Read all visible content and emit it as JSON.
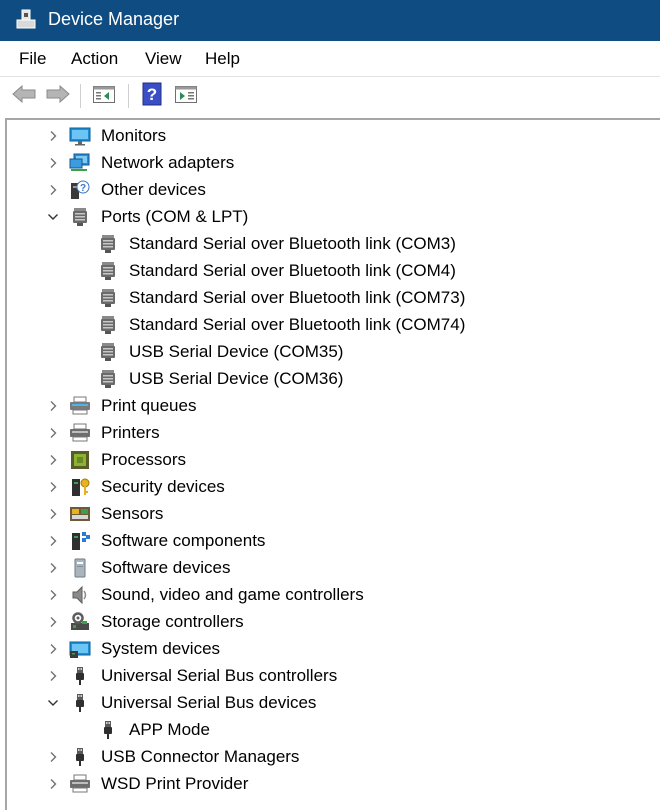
{
  "window": {
    "title": "Device Manager"
  },
  "menu": [
    "File",
    "Action",
    "View",
    "Help"
  ],
  "toolbar": [
    {
      "name": "back-button",
      "icon": "arrow-left-icon"
    },
    {
      "name": "forward-button",
      "icon": "arrow-right-icon"
    },
    {
      "name": "show-hide-console-tree-button",
      "icon": "console-tree-icon"
    },
    {
      "name": "help-button",
      "icon": "help-icon"
    },
    {
      "name": "show-hide-action-pane-button",
      "icon": "action-pane-icon"
    }
  ],
  "tree": [
    {
      "label": "Monitors",
      "level": 0,
      "expander": "collapsed",
      "icon": "monitor-icon"
    },
    {
      "label": "Network adapters",
      "level": 0,
      "expander": "collapsed",
      "icon": "network-adapter-icon"
    },
    {
      "label": "Other devices",
      "level": 0,
      "expander": "collapsed",
      "icon": "unknown-device-icon"
    },
    {
      "label": "Ports (COM & LPT)",
      "level": 0,
      "expander": "expanded",
      "icon": "port-icon"
    },
    {
      "label": "Standard Serial over Bluetooth link (COM3)",
      "level": 1,
      "expander": "none",
      "icon": "port-icon"
    },
    {
      "label": "Standard Serial over Bluetooth link (COM4)",
      "level": 1,
      "expander": "none",
      "icon": "port-icon"
    },
    {
      "label": "Standard Serial over Bluetooth link (COM73)",
      "level": 1,
      "expander": "none",
      "icon": "port-icon"
    },
    {
      "label": "Standard Serial over Bluetooth link (COM74)",
      "level": 1,
      "expander": "none",
      "icon": "port-icon"
    },
    {
      "label": "USB Serial Device (COM35)",
      "level": 1,
      "expander": "none",
      "icon": "port-icon"
    },
    {
      "label": "USB Serial Device (COM36)",
      "level": 1,
      "expander": "none",
      "icon": "port-icon"
    },
    {
      "label": "Print queues",
      "level": 0,
      "expander": "collapsed",
      "icon": "print-queue-icon"
    },
    {
      "label": "Printers",
      "level": 0,
      "expander": "collapsed",
      "icon": "printer-icon"
    },
    {
      "label": "Processors",
      "level": 0,
      "expander": "collapsed",
      "icon": "processor-icon"
    },
    {
      "label": "Security devices",
      "level": 0,
      "expander": "collapsed",
      "icon": "security-device-icon"
    },
    {
      "label": "Sensors",
      "level": 0,
      "expander": "collapsed",
      "icon": "sensor-icon"
    },
    {
      "label": "Software components",
      "level": 0,
      "expander": "collapsed",
      "icon": "software-component-icon"
    },
    {
      "label": "Software devices",
      "level": 0,
      "expander": "collapsed",
      "icon": "software-device-icon"
    },
    {
      "label": "Sound, video and game controllers",
      "level": 0,
      "expander": "collapsed",
      "icon": "speaker-icon"
    },
    {
      "label": "Storage controllers",
      "level": 0,
      "expander": "collapsed",
      "icon": "storage-controller-icon"
    },
    {
      "label": "System devices",
      "level": 0,
      "expander": "collapsed",
      "icon": "system-device-icon"
    },
    {
      "label": "Universal Serial Bus controllers",
      "level": 0,
      "expander": "collapsed",
      "icon": "usb-icon"
    },
    {
      "label": "Universal Serial Bus devices",
      "level": 0,
      "expander": "expanded",
      "icon": "usb-icon"
    },
    {
      "label": "APP Mode",
      "level": 1,
      "expander": "none",
      "icon": "usb-icon"
    },
    {
      "label": "USB Connector Managers",
      "level": 0,
      "expander": "collapsed",
      "icon": "usb-icon"
    },
    {
      "label": "WSD Print Provider",
      "level": 0,
      "expander": "collapsed",
      "icon": "printer-icon"
    }
  ]
}
